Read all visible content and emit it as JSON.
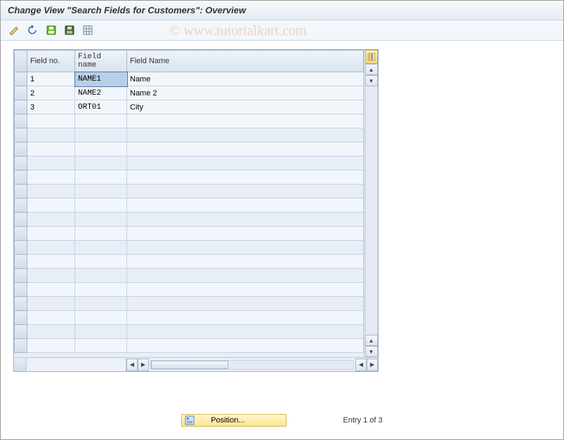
{
  "title": "Change View \"Search Fields for Customers\": Overview",
  "watermark": "© www.tutorialkart.com",
  "toolbar": {
    "icons": [
      "edit-icon",
      "undo-icon",
      "save-green-icon",
      "save-dark-icon",
      "grid-icon"
    ]
  },
  "table": {
    "columns": [
      "Field no.",
      "Field name",
      "Field Name"
    ],
    "rows": [
      {
        "no": "1",
        "fname": "NAME1",
        "desc": "Name",
        "selected": true
      },
      {
        "no": "2",
        "fname": "NAME2",
        "desc": "Name 2",
        "selected": false
      },
      {
        "no": "3",
        "fname": "ORT01",
        "desc": "City",
        "selected": false
      }
    ],
    "empty_rows": 17
  },
  "footer": {
    "position_label": "Position...",
    "entry_status": "Entry 1 of 3"
  }
}
